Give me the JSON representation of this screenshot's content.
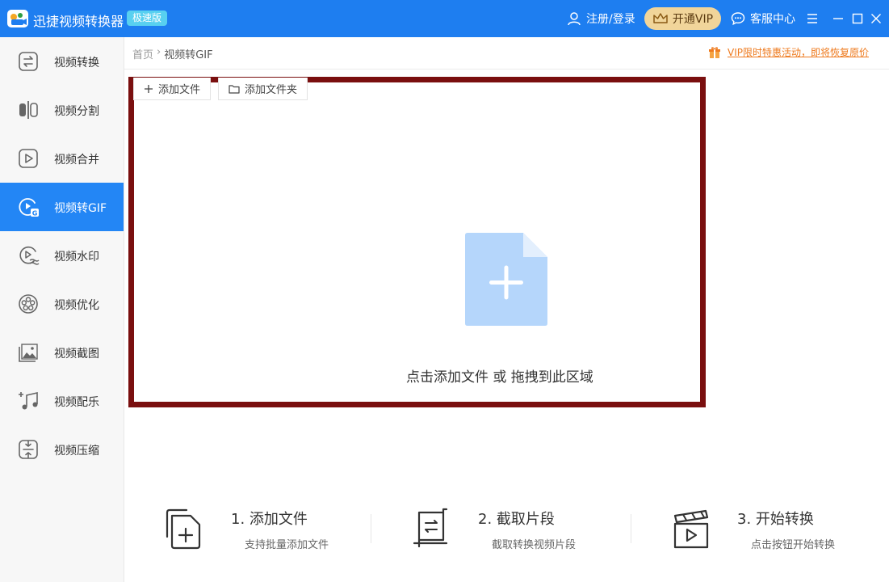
{
  "titlebar": {
    "app_title": "迅捷视频转换器",
    "edition": "极速版",
    "login": "注册/登录",
    "vip": "开通VIP",
    "service": "客服中心",
    "accent": "#1e7ef0"
  },
  "sidebar": {
    "items": [
      {
        "label": "视频转换",
        "icon": "convert-icon"
      },
      {
        "label": "视频分割",
        "icon": "split-icon"
      },
      {
        "label": "视频合并",
        "icon": "merge-icon"
      },
      {
        "label": "视频转GIF",
        "icon": "gif-icon",
        "active": true
      },
      {
        "label": "视频水印",
        "icon": "watermark-icon"
      },
      {
        "label": "视频优化",
        "icon": "film-reel-icon"
      },
      {
        "label": "视频截图",
        "icon": "image-icon"
      },
      {
        "label": "视频配乐",
        "icon": "music-note-icon"
      },
      {
        "label": "视频压缩",
        "icon": "compress-icon"
      }
    ]
  },
  "breadcrumb": {
    "home": "首页",
    "separator": "›",
    "current": "视频转GIF"
  },
  "promo": "VIP限时特惠活动，即将恢复原价",
  "toolbar": {
    "add_file": "添加文件",
    "add_folder": "添加文件夹"
  },
  "dropzone": {
    "hint": "点击添加文件 或 拖拽到此区域"
  },
  "steps": [
    {
      "title": "1. 添加文件",
      "desc": "支持批量添加文件"
    },
    {
      "title": "2. 截取片段",
      "desc": "截取转换视频片段"
    },
    {
      "title": "3. 开始转换",
      "desc": "点击按钮开始转换"
    }
  ]
}
